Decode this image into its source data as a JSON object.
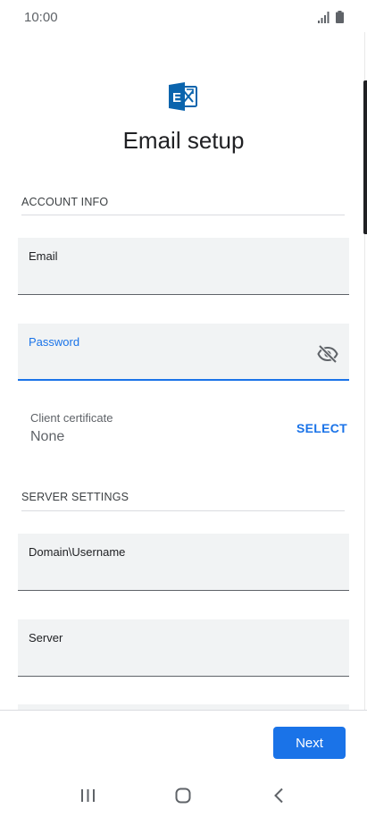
{
  "status_bar": {
    "time": "10:00",
    "icons": [
      "signal-icon",
      "battery-icon"
    ]
  },
  "header": {
    "logo": "exchange-logo",
    "title": "Email setup"
  },
  "account_info": {
    "header": "ACCOUNT INFO",
    "email_label": "Email",
    "email_value": "",
    "password_label": "Password",
    "password_value": "",
    "password_toggle_icon": "eye-off-icon",
    "certificate": {
      "label": "Client certificate",
      "value": "None",
      "action": "SELECT"
    }
  },
  "server_settings": {
    "header": "SERVER SETTINGS",
    "domain_username_label": "Domain\\Username",
    "domain_username_value": "",
    "server_label": "Server",
    "server_value": ""
  },
  "footer": {
    "next_label": "Next"
  },
  "nav": {
    "icons": [
      "recents-icon",
      "home-icon",
      "back-icon"
    ]
  },
  "colors": {
    "accent": "#1a73e8",
    "field_background": "#f1f3f4",
    "logo_blue": "#0a64ad"
  }
}
